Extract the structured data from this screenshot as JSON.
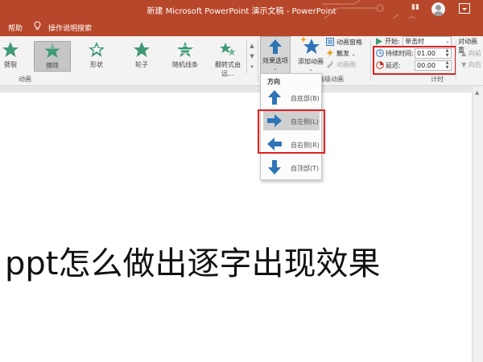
{
  "window": {
    "title": "新建 Microsoft PowerPoint 演示文稿 - PowerPoint",
    "account_name": "▮▮"
  },
  "menubar": {
    "help": "帮助",
    "tell_me": "操作说明搜索"
  },
  "ribbon": {
    "animations": [
      {
        "label": "劈裂",
        "selected": false
      },
      {
        "label": "擦除",
        "selected": true
      },
      {
        "label": "形状",
        "selected": false
      },
      {
        "label": "轮子",
        "selected": false
      },
      {
        "label": "随机线条",
        "selected": false
      },
      {
        "label": "翻转式由远...",
        "selected": false
      }
    ],
    "group_animation": "动画",
    "effect_options": "效果选项",
    "add_animation": "添加动画",
    "animation_pane": "动画窗格",
    "trigger": "触发",
    "anim_painter": "动画刷",
    "group_advanced": "高级动画",
    "start_label": "开始:",
    "start_value": "单击时",
    "duration_label": "持续时间:",
    "duration_value": "01.00",
    "delay_label": "延迟:",
    "delay_value": "00.00",
    "reorder_title": "对动画重",
    "move_earlier": "向前",
    "move_later": "向后",
    "group_timing": "计时",
    "accent_green": "#3f9b74",
    "accent_blue": "#2e75b6"
  },
  "dropdown": {
    "header": "方向",
    "options": [
      {
        "label": "自底部(B)",
        "icon": "arrow-up-icon"
      },
      {
        "label": "自左侧(L)",
        "icon": "arrow-right-icon"
      },
      {
        "label": "自右侧(R)",
        "icon": "arrow-left-icon"
      },
      {
        "label": "自顶部(T)",
        "icon": "arrow-down-icon"
      }
    ]
  },
  "slide": {
    "text": "ppt怎么做出逐字出现效果"
  }
}
